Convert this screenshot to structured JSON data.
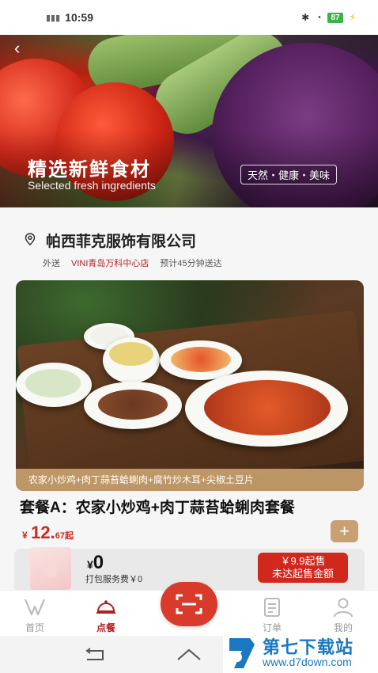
{
  "status_bar": {
    "time": "10:59",
    "battery": "87"
  },
  "hero": {
    "title": "精选新鲜食材",
    "subtitle": "Selected fresh ingredients",
    "tag": "天然・健康・美味"
  },
  "store": {
    "name": "帕西菲克服饰有限公司",
    "mode": "外送",
    "branch": "VINI青岛万科中心店",
    "eta": "预计45分钟送达"
  },
  "product": {
    "caption": "农家小炒鸡+肉丁蒜苔蛤蜊肉+腐竹炒木耳+尖椒土豆片",
    "title": "套餐A：农家小炒鸡+肉丁蒜苔蛤蜊肉套餐",
    "price_symbol": "¥",
    "price": "12.",
    "price_decimal": "67起",
    "add_label": "+"
  },
  "cart": {
    "symbol": "¥",
    "total": "0",
    "packing_fee": "打包服务费￥0",
    "cta_line1": "￥9.9起售",
    "cta_line2": "未达起售金额"
  },
  "nav": {
    "home": "首页",
    "order": "点餐",
    "orders": "订单",
    "mine": "我的",
    "accent": "#b02020"
  },
  "watermark": {
    "title": "第七下载站",
    "url": "www.d7down.com"
  }
}
